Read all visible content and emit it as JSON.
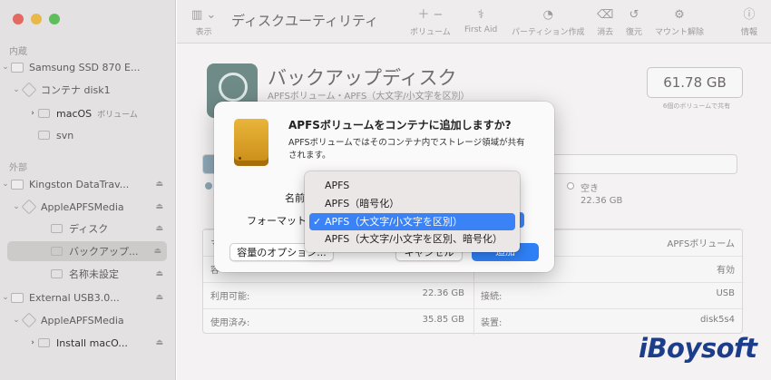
{
  "toolbar": {
    "title": "ディスクユーティリティ",
    "view_label": "表示",
    "buttons": [
      {
        "label": "ボリューム",
        "icon": "plus-minus-icon"
      },
      {
        "label": "First Aid",
        "icon": "stethoscope-icon"
      },
      {
        "label": "パーティション作成",
        "icon": "pie-icon"
      },
      {
        "label": "消去",
        "icon": "eraser-icon"
      },
      {
        "label": "復元",
        "icon": "restore-icon"
      },
      {
        "label": "マウント解除",
        "icon": "eject-icon"
      },
      {
        "label": "情報",
        "icon": "info-icon"
      }
    ]
  },
  "sidebar": {
    "section_internal": "内蔵",
    "section_external": "外部",
    "items": [
      {
        "label": "Samsung SSD 870 E..."
      },
      {
        "label": "コンテナ disk1"
      },
      {
        "label": "macOS",
        "sub": "ボリューム"
      },
      {
        "label": "svn"
      },
      {
        "label": "Kingston DataTrav..."
      },
      {
        "label": "AppleAPFSMedia"
      },
      {
        "label": "ディスク"
      },
      {
        "label": "バックアップ..."
      },
      {
        "label": "名称未設定"
      },
      {
        "label": "External USB3.0..."
      },
      {
        "label": "AppleAPFSMedia"
      },
      {
        "label": "Install macO..."
      }
    ]
  },
  "volume": {
    "title": "バックアップディスク",
    "subtitle": "APFSボリューム・APFS（大文字/小文字を区別）",
    "capacity": "61.78 GB",
    "capacity_note": "6個のボリュームで共有",
    "used_fraction": 0.02,
    "free_label": "空き",
    "free_value": "22.36 GB"
  },
  "info": {
    "rows": [
      {
        "left_label": "マ",
        "left_value": "",
        "right_label": "",
        "right_value": "APFSボリューム"
      },
      {
        "left_label": "容",
        "left_value": "",
        "right_label": "",
        "right_value": "有効"
      },
      {
        "left_label": "利用可能:",
        "left_value": "22.36 GB",
        "right_label": "接続:",
        "right_value": "USB"
      },
      {
        "left_label": "使用済み:",
        "left_value": "35.85 GB",
        "right_label": "装置:",
        "right_value": "disk5s4"
      }
    ]
  },
  "dialog": {
    "title": "APFSボリュームをコンテナに追加しますか?",
    "body": "APFSボリュームではそのコンテナ内でストレージ領域が共有されます。",
    "name_label": "名前",
    "format_label": "フォーマット",
    "options_button": "容量のオプション...",
    "cancel_button": "キャンセル",
    "add_button": "追加"
  },
  "format_menu": {
    "check": "✓",
    "items": [
      {
        "label": "APFS"
      },
      {
        "label": "APFS（暗号化）"
      },
      {
        "label": "APFS（大文字/小文字を区別）"
      },
      {
        "label": "APFS（大文字/小文字を区別、暗号化）"
      }
    ]
  },
  "watermark": "iBoysoft",
  "colors": {
    "accent": "#3b82f6",
    "close": "#fe5f57",
    "minimize": "#febc2e",
    "zoom": "#28c840"
  }
}
